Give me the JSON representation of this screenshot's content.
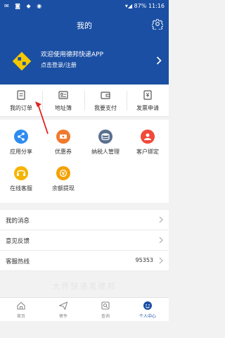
{
  "status_bar": {
    "left_icons": [
      "mail-icon",
      "message-icon",
      "tag-icon",
      "chat-icon"
    ],
    "battery": "87%",
    "time": "11:16"
  },
  "nav": {
    "title": "我的"
  },
  "profile": {
    "welcome": "欢迎使用德邦快递APP",
    "login_prompt": "点击登录/注册"
  },
  "quick_actions": [
    {
      "label": "我的订单",
      "icon": "order-icon"
    },
    {
      "label": "地址簿",
      "icon": "address-book-icon"
    },
    {
      "label": "我要支付",
      "icon": "wallet-icon"
    },
    {
      "label": "发票申请",
      "icon": "invoice-icon"
    }
  ],
  "services": [
    {
      "label": "应用分享",
      "icon": "share-icon",
      "color": "#2e8bf0"
    },
    {
      "label": "优惠券",
      "icon": "coupon-icon",
      "color": "#f07a2e"
    },
    {
      "label": "纳税人管理",
      "icon": "taxpayer-icon",
      "color": "#5a6f8e"
    },
    {
      "label": "客户绑定",
      "icon": "customer-bind-icon",
      "color": "#f04a3a"
    },
    {
      "label": "在线客服",
      "icon": "online-service-icon",
      "color": "#f5b400"
    },
    {
      "label": "余额提现",
      "icon": "withdraw-icon",
      "color": "#f5a000"
    }
  ],
  "menu": [
    {
      "label": "我的消息",
      "value": ""
    },
    {
      "label": "意见反馈",
      "value": ""
    },
    {
      "label": "客服热线",
      "value": "95353"
    }
  ],
  "watermark": "大件快递发德邦",
  "tabs": [
    {
      "label": "首页",
      "icon": "home-icon",
      "active": false
    },
    {
      "label": "寄件",
      "icon": "send-icon",
      "active": false
    },
    {
      "label": "查询",
      "icon": "query-icon",
      "active": false
    },
    {
      "label": "个人中心",
      "icon": "profile-icon",
      "active": true
    }
  ],
  "colors": {
    "brand": "#1a4fa3",
    "logo_yellow": "#f5c800",
    "pointer_red": "#e02020"
  }
}
